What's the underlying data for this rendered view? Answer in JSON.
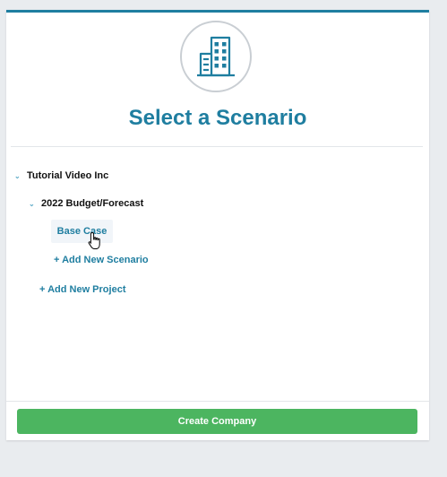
{
  "header": {
    "title": "Select a Scenario",
    "logo_icon": "building-icon"
  },
  "tree": {
    "company": {
      "label": "Tutorial Video Inc",
      "expanded": true
    },
    "project": {
      "label": "2022 Budget/Forecast",
      "expanded": true
    },
    "scenario": {
      "label": "Base Case"
    },
    "add_scenario": {
      "label": "+ Add New Scenario"
    },
    "add_project": {
      "label": "+ Add New Project"
    }
  },
  "footer": {
    "create_button": "Create Company"
  },
  "colors": {
    "accent": "#1f7ea0",
    "button": "#4cb560",
    "chevron": "#5ba9c6"
  }
}
